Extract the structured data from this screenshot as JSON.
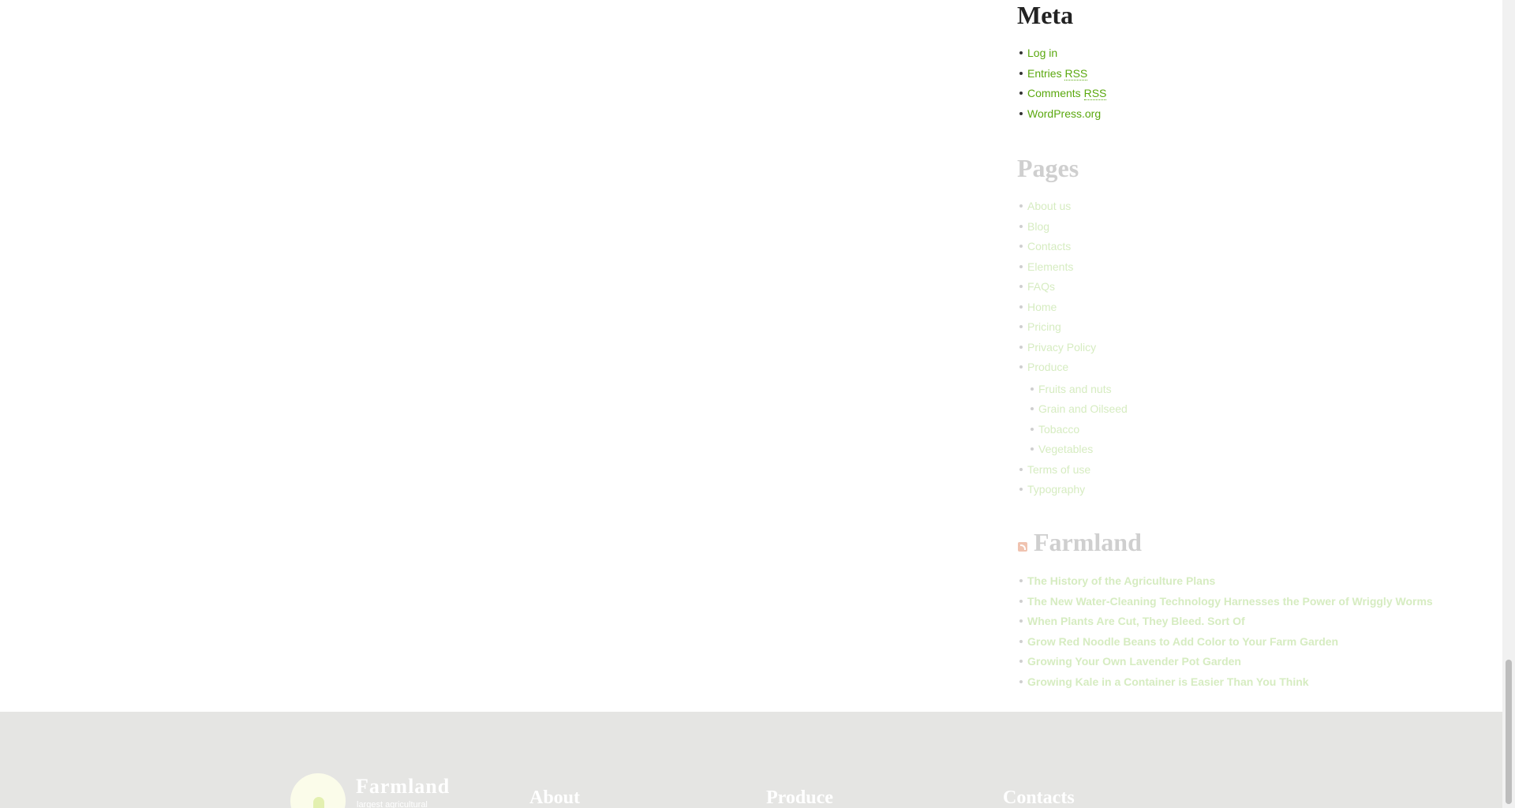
{
  "sidebar": {
    "meta": {
      "title": "Meta",
      "items": [
        {
          "pre": "Log in",
          "abbr": ""
        },
        {
          "pre": "Entries ",
          "abbr": "RSS"
        },
        {
          "pre": "Comments ",
          "abbr": "RSS"
        },
        {
          "pre": "WordPress.org",
          "abbr": ""
        }
      ]
    },
    "pages": {
      "title": "Pages",
      "items": [
        "About us",
        "Blog",
        "Contacts",
        "Elements",
        "FAQs",
        "Home",
        "Pricing",
        "Privacy Policy",
        "Produce"
      ],
      "produce_children": [
        "Fruits and nuts",
        "Grain and Oilseed",
        "Tobacco",
        "Vegetables"
      ],
      "items_after": [
        "Terms of use",
        "Typography"
      ]
    },
    "rss": {
      "icon": "rss-icon",
      "title": "Farmland",
      "items": [
        "The History of the Agriculture Plans",
        "The New Water-Cleaning Technology Harnesses the Power of Wriggly Worms",
        "When Plants Are Cut, They Bleed. Sort Of",
        "Grow Red Noodle Beans to Add Color to Your Farm Garden",
        "Growing Your Own Lavender Pot Garden",
        "Growing Kale in a Container is Easier Than You Think"
      ]
    }
  },
  "footer": {
    "brand_name": "Farmland",
    "brand_tagline": "largest agricultural",
    "columns": [
      "About",
      "Produce",
      "Contacts"
    ]
  },
  "colors": {
    "accent": "#5aa80e",
    "footer_bg": "#e5e5e3"
  }
}
